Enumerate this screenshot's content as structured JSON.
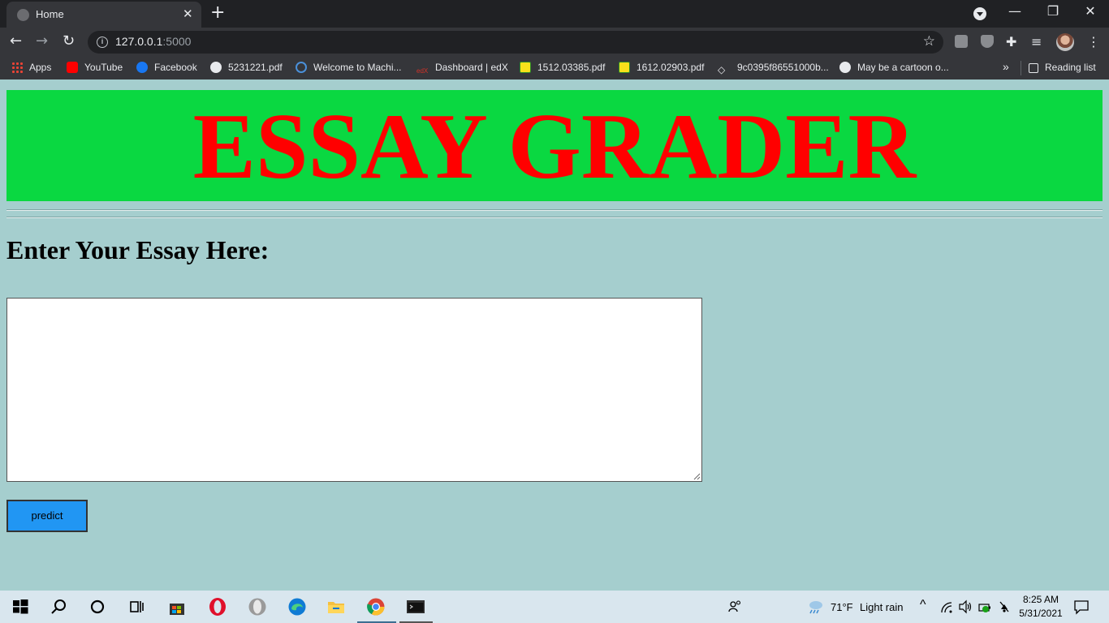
{
  "browser": {
    "tab_title": "Home",
    "tab_close": "✕",
    "new_tab": "+",
    "window_controls": {
      "minimize": "—",
      "restore": "❐",
      "close": "✕"
    },
    "url_host": "127.0.0.1",
    "url_port": ":5000",
    "bookmarks": [
      {
        "label": "Apps",
        "icon": "apps-grid-icon"
      },
      {
        "label": "YouTube",
        "icon": "youtube-icon",
        "color": "#ff0000"
      },
      {
        "label": "Facebook",
        "icon": "facebook-icon",
        "color": "#1877f2"
      },
      {
        "label": "5231221.pdf",
        "icon": "globe-icon",
        "color": "#e8eaed"
      },
      {
        "label": "Welcome to Machi...",
        "icon": "coursera-icon",
        "color": "#4a90d9"
      },
      {
        "label": "Dashboard | edX",
        "icon": "edx-icon",
        "color": "#d23228"
      },
      {
        "label": "1512.03385.pdf",
        "icon": "arxiv-smiley-icon",
        "color": "#f7e11b"
      },
      {
        "label": "1612.02903.pdf",
        "icon": "arxiv-smiley-icon",
        "color": "#f7e11b"
      },
      {
        "label": "9c0395f86551000b...",
        "icon": "diamond-icon",
        "color": "#e8eaed"
      },
      {
        "label": "May be a cartoon o...",
        "icon": "globe-icon",
        "color": "#e8eaed"
      }
    ],
    "bookmarks_overflow": "»",
    "reading_list": "Reading list"
  },
  "page": {
    "banner_title": "ESSAY GRADER",
    "heading": "Enter Your Essay Here:",
    "essay_value": "",
    "predict_label": "predict"
  },
  "colors": {
    "banner_bg": "#0ad841",
    "banner_text": "#ff0000",
    "page_bg": "#a5cece",
    "button_bg": "#2196f3"
  },
  "taskbar": {
    "weather_temp": "71°F",
    "weather_desc": "Light rain",
    "time": "8:25 AM",
    "date": "5/31/2021"
  }
}
